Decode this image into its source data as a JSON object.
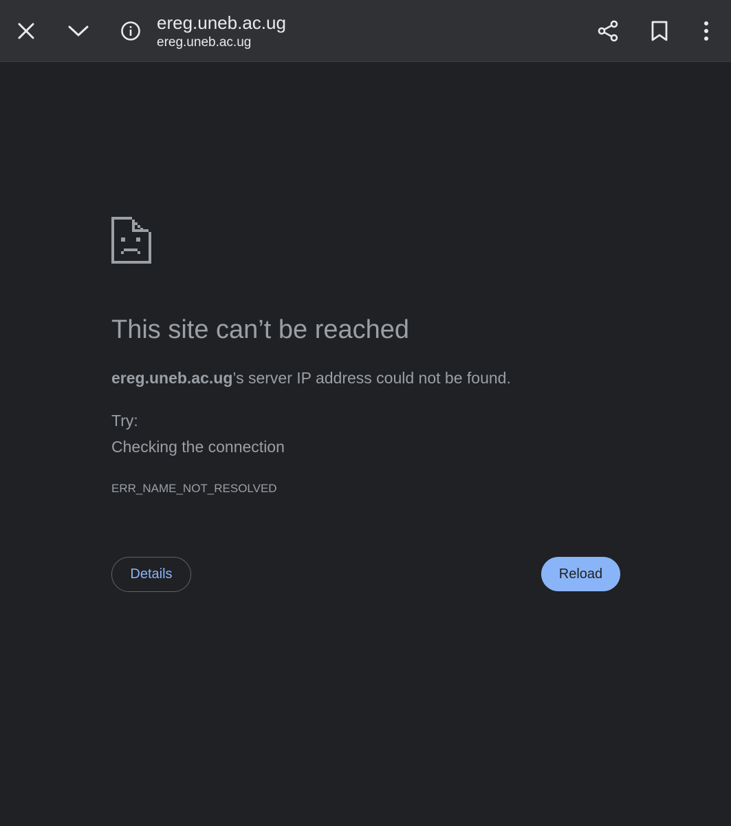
{
  "toolbar": {
    "title": "ereg.uneb.ac.ug",
    "subtitle": "ereg.uneb.ac.ug",
    "icons": {
      "close": "close-icon",
      "minimize": "chevron-down-icon",
      "info": "info-icon",
      "share": "share-icon",
      "bookmark": "bookmark-icon",
      "menu": "more-vert-icon"
    }
  },
  "error": {
    "icon": "sad-page-icon",
    "heading": "This site can’t be reached",
    "host": "ereg.uneb.ac.ug",
    "message_suffix": "’s server IP address could not be found.",
    "try_label": "Try:",
    "suggestion": "Checking the connection",
    "code": "ERR_NAME_NOT_RESOLVED"
  },
  "buttons": {
    "details": "Details",
    "reload": "Reload"
  },
  "colors": {
    "page_background": "#202124",
    "toolbar_background": "#303134",
    "text_primary": "#e8eaed",
    "text_secondary": "#9aa0a6",
    "accent": "#8ab4f8"
  }
}
